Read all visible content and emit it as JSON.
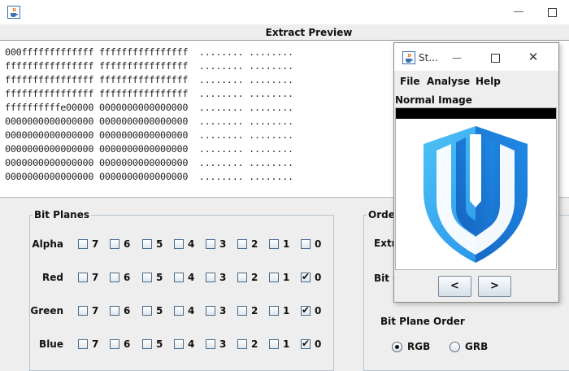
{
  "window": {
    "app_icon": "java-cup-icon",
    "minimize_label": "—",
    "maximize_icon": "maximize-icon"
  },
  "preview": {
    "title": "Extract Preview",
    "lines": [
      "000fffffffffffff ffffffffffffffff  ........ ........",
      "ffffffffffffffff ffffffffffffffff  ........ ........",
      "ffffffffffffffff ffffffffffffffff  ........ ........",
      "ffffffffffffffff ffffffffffffffff  ........ ........",
      "ffffffffffe00000 0000000000000000  ........ ........",
      "0000000000000000 0000000000000000  ........ ........",
      "0000000000000000 0000000000000000  ........ ........",
      "0000000000000000 0000000000000000  ........ ........",
      "0000000000000000 0000000000000000  ........ ........",
      "0000000000000000 0000000000000000  ........ ........"
    ]
  },
  "bit_planes": {
    "title": "Bit Planes",
    "bits": [
      "7",
      "6",
      "5",
      "4",
      "3",
      "2",
      "1",
      "0"
    ],
    "rows": [
      {
        "label": "Alpha",
        "checked": [
          false,
          false,
          false,
          false,
          false,
          false,
          false,
          false
        ]
      },
      {
        "label": "Red",
        "checked": [
          false,
          false,
          false,
          false,
          false,
          false,
          false,
          true
        ]
      },
      {
        "label": "Green",
        "checked": [
          false,
          false,
          false,
          false,
          false,
          false,
          false,
          true
        ]
      },
      {
        "label": "Blue",
        "checked": [
          false,
          false,
          false,
          false,
          false,
          false,
          false,
          true
        ]
      }
    ]
  },
  "order": {
    "title": "Orde",
    "extract_by_label": "Extr",
    "bit_order_label": "Bit C",
    "bit_plane_order_label": "Bit Plane Order",
    "options": [
      {
        "label": "RGB",
        "selected": true
      },
      {
        "label": "GRB",
        "selected": false
      }
    ]
  },
  "dialog": {
    "title": "St...",
    "minimize_label": "—",
    "close_label": "✕",
    "menu": [
      "File",
      "Analyse",
      "Help"
    ],
    "mode_label": "Normal Image",
    "prev_label": "<",
    "next_label": ">",
    "image_icon": "shield-logo-icon"
  },
  "colors": {
    "shield_dark": "#1565c0",
    "shield_mid": "#1e88e5",
    "shield_light": "#4fc3f7"
  }
}
